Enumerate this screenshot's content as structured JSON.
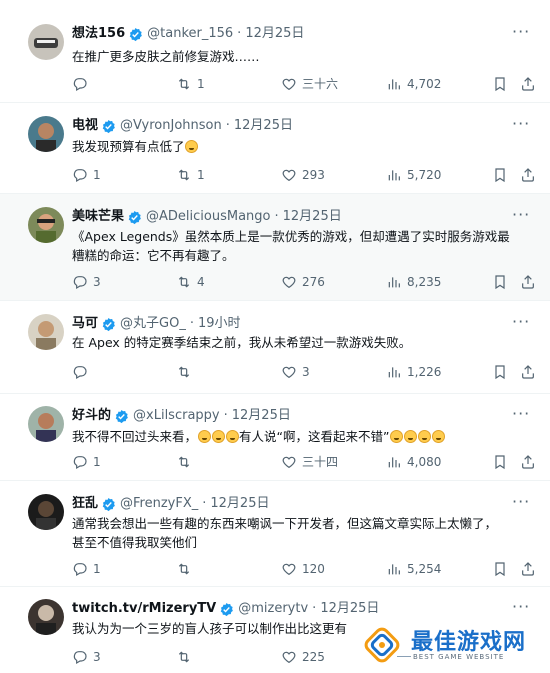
{
  "tweets": [
    {
      "name": "想法156",
      "verified": true,
      "handle": "@tanker_156",
      "time": "12月25日",
      "text_lines": [
        "在推广更多皮肤之前修复游戏……"
      ],
      "replies": "",
      "retweets": "1",
      "likes": "三十六",
      "views": "4,702"
    },
    {
      "name": "电视",
      "verified": true,
      "handle": "@VyronJohnson",
      "time": "12月25日",
      "text_lines": [
        "我发现预算有点低了"
      ],
      "emoji_after": 1,
      "replies": "1",
      "retweets": "1",
      "likes": "293",
      "views": "5,720"
    },
    {
      "name": "美味芒果",
      "verified": true,
      "handle": "@ADeliciousMango",
      "time": "12月25日",
      "text_lines": [
        "《Apex Legends》虽然本质上是一款优秀的游戏，但却遭遇了实时服务游戏最",
        "糟糕的命运：它不再有趣了。"
      ],
      "replies": "3",
      "retweets": "4",
      "likes": "276",
      "views": "8,235"
    },
    {
      "name": "马可",
      "verified": true,
      "handle": "@丸子GO_",
      "time": "19小时",
      "text_lines": [
        "在 Apex 的特定赛季结束之前，我从未希望过一款游戏失败。"
      ],
      "replies": "",
      "retweets": "",
      "likes": "3",
      "views": "1,226"
    },
    {
      "name": "好斗的",
      "verified": true,
      "handle": "@xLilscrappy",
      "time": "12月25日",
      "text_parts": [
        "我不得不回过头来看，",
        "有人说“啊，这看起来不错”"
      ],
      "emoji_counts": [
        3,
        4
      ],
      "replies": "1",
      "retweets": "",
      "likes": "三十四",
      "views": "4,080"
    },
    {
      "name": "狂乱",
      "verified": true,
      "handle": "@FrenzyFX_",
      "time": "12月25日",
      "text_lines": [
        "通常我会想出一些有趣的东西来嘲讽一下开发者，但这篇文章实际上太懒了，",
        "甚至不值得我取笑他们"
      ],
      "replies": "1",
      "retweets": "",
      "likes": "120",
      "views": "5,254"
    },
    {
      "name": "twitch.tv/rMizeryTV",
      "verified": true,
      "handle": "@mizerytv",
      "time": "12月25日",
      "text_lines": [
        "我认为为一个三岁的盲人孩子可以制作出比这更有"
      ],
      "replies": "3",
      "retweets": "",
      "likes": "225",
      "views": ""
    }
  ],
  "watermark": {
    "title": "最佳游戏网",
    "subtitle": "BEST GAME WEBSITE"
  },
  "colors": {
    "verified": "#1d9bf0",
    "text": "#0f1419",
    "muted": "#536471",
    "divider": "#eff3f4",
    "highlight_bg": "#f7f9f9",
    "watermark_blue": "#1a6fc9",
    "watermark_orange": "#f39c12"
  },
  "icons": {
    "reply": "reply-icon",
    "retweet": "retweet-icon",
    "like": "heart-icon",
    "views": "views-icon",
    "bookmark": "bookmark-icon",
    "share": "share-icon",
    "more": "more-icon",
    "verified": "verified-badge-icon"
  }
}
